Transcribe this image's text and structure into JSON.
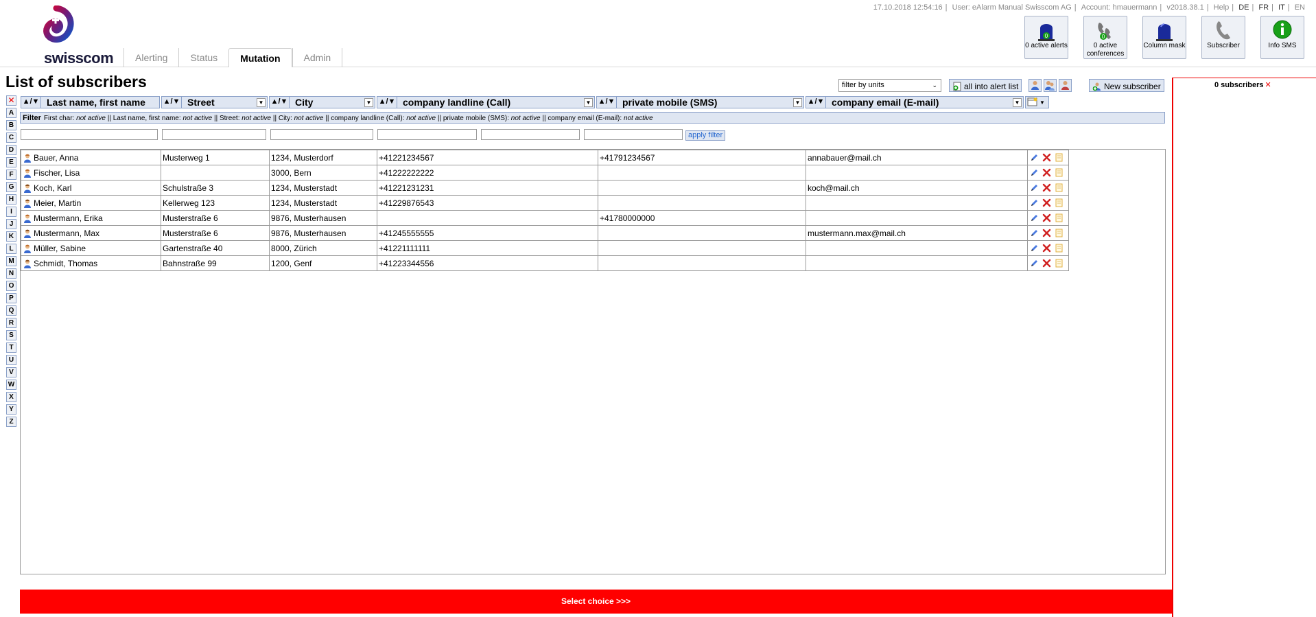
{
  "brand": {
    "logo_text": "swisscom"
  },
  "header": {
    "datetime": "17.10.2018 12:54:16",
    "user": "User: eAlarm Manual Swisscom AG",
    "account": "Account: hmauermann",
    "version": "v2018.38.1",
    "help": "Help",
    "languages": [
      "DE",
      "FR",
      "IT",
      "EN"
    ],
    "separator": "|"
  },
  "nav": {
    "tabs": [
      "Alerting",
      "Status",
      "Mutation",
      "Admin"
    ],
    "active": "Mutation"
  },
  "quick_buttons": [
    {
      "label": "0 active alerts",
      "icon": "alarm-light-icon",
      "badge": "0"
    },
    {
      "label": "0 active conferences",
      "icon": "conference-phone-icon",
      "badge": "0"
    },
    {
      "label": "Column mask",
      "icon": "column-mask-light-icon"
    },
    {
      "label": "Subscriber",
      "icon": "phone-handset-icon"
    },
    {
      "label": "Info SMS",
      "icon": "info-icon"
    }
  ],
  "page": {
    "title": "List of subscribers"
  },
  "toolbar": {
    "unit_filter": "filter by units",
    "all_into_alert_list": "all into alert list",
    "new_subscriber": "New subscriber"
  },
  "right_panel": {
    "count_label": "0 subscribers",
    "clear": "✕"
  },
  "alphabet": [
    "A",
    "B",
    "C",
    "D",
    "E",
    "F",
    "G",
    "H",
    "I",
    "J",
    "K",
    "L",
    "M",
    "N",
    "O",
    "P",
    "Q",
    "R",
    "S",
    "T",
    "U",
    "V",
    "W",
    "X",
    "Y",
    "Z"
  ],
  "columns": [
    {
      "label": "Last name, first name",
      "sort": "▲/▼"
    },
    {
      "label": "Street",
      "sort": "▲/▼"
    },
    {
      "label": "City",
      "sort": "▲/▼"
    },
    {
      "label": "company landline (Call)",
      "sort": "▲/▼"
    },
    {
      "label": "private mobile (SMS)",
      "sort": "▲/▼"
    },
    {
      "label": "company email (E-mail)",
      "sort": "▲/▼"
    }
  ],
  "filter": {
    "label": "Filter",
    "parts": [
      {
        "name": "First char:",
        "state": "not active"
      },
      {
        "name": "Last name, first name:",
        "state": "not active"
      },
      {
        "name": "Street:",
        "state": "not active"
      },
      {
        "name": "City:",
        "state": "not active"
      },
      {
        "name": "company landline (Call):",
        "state": "not active"
      },
      {
        "name": "private mobile (SMS):",
        "state": "not active"
      },
      {
        "name": "company email (E-mail):",
        "state": "not active"
      }
    ],
    "apply_label": "apply filter"
  },
  "subscribers": [
    {
      "name": "Bauer, Anna",
      "street": "Musterweg 1",
      "city": "1234, Musterdorf",
      "landline": "+41221234567",
      "mobile": "+41791234567",
      "email": "annabauer@mail.ch",
      "gender": "female"
    },
    {
      "name": "Fischer, Lisa",
      "street": "",
      "city": "3000, Bern",
      "landline": "+41222222222",
      "mobile": "",
      "email": "",
      "gender": "female"
    },
    {
      "name": "Koch, Karl",
      "street": "Schulstraße 3",
      "city": "1234, Musterstadt",
      "landline": "+41221231231",
      "mobile": "",
      "email": "koch@mail.ch",
      "gender": "male"
    },
    {
      "name": "Meier, Martin",
      "street": "Kellerweg 123",
      "city": "1234, Musterstadt",
      "landline": "+41229876543",
      "mobile": "",
      "email": "",
      "gender": "male"
    },
    {
      "name": "Mustermann, Erika",
      "street": "Musterstraße 6",
      "city": "9876, Musterhausen",
      "landline": "",
      "mobile": "+41780000000",
      "email": "",
      "gender": "female"
    },
    {
      "name": "Mustermann, Max",
      "street": "Musterstraße 6",
      "city": "9876, Musterhausen",
      "landline": "+41245555555",
      "mobile": "",
      "email": "mustermann.max@mail.ch",
      "gender": "male"
    },
    {
      "name": "Müller, Sabine",
      "street": "Gartenstraße 40",
      "city": "8000, Zürich",
      "landline": "+41221111111",
      "mobile": "",
      "email": "",
      "gender": "female"
    },
    {
      "name": "Schmidt, Thomas",
      "street": "Bahnstraße 99",
      "city": "1200, Genf",
      "landline": "+41223344556",
      "mobile": "",
      "email": "",
      "gender": "male"
    }
  ],
  "bottom": {
    "select_choice": "Select choice >>>"
  },
  "colors": {
    "accent_red": "#ff0000",
    "button_bg": "#dfe6f2",
    "button_border": "#8aa0c8",
    "header_navy": "#1a1a3a"
  }
}
